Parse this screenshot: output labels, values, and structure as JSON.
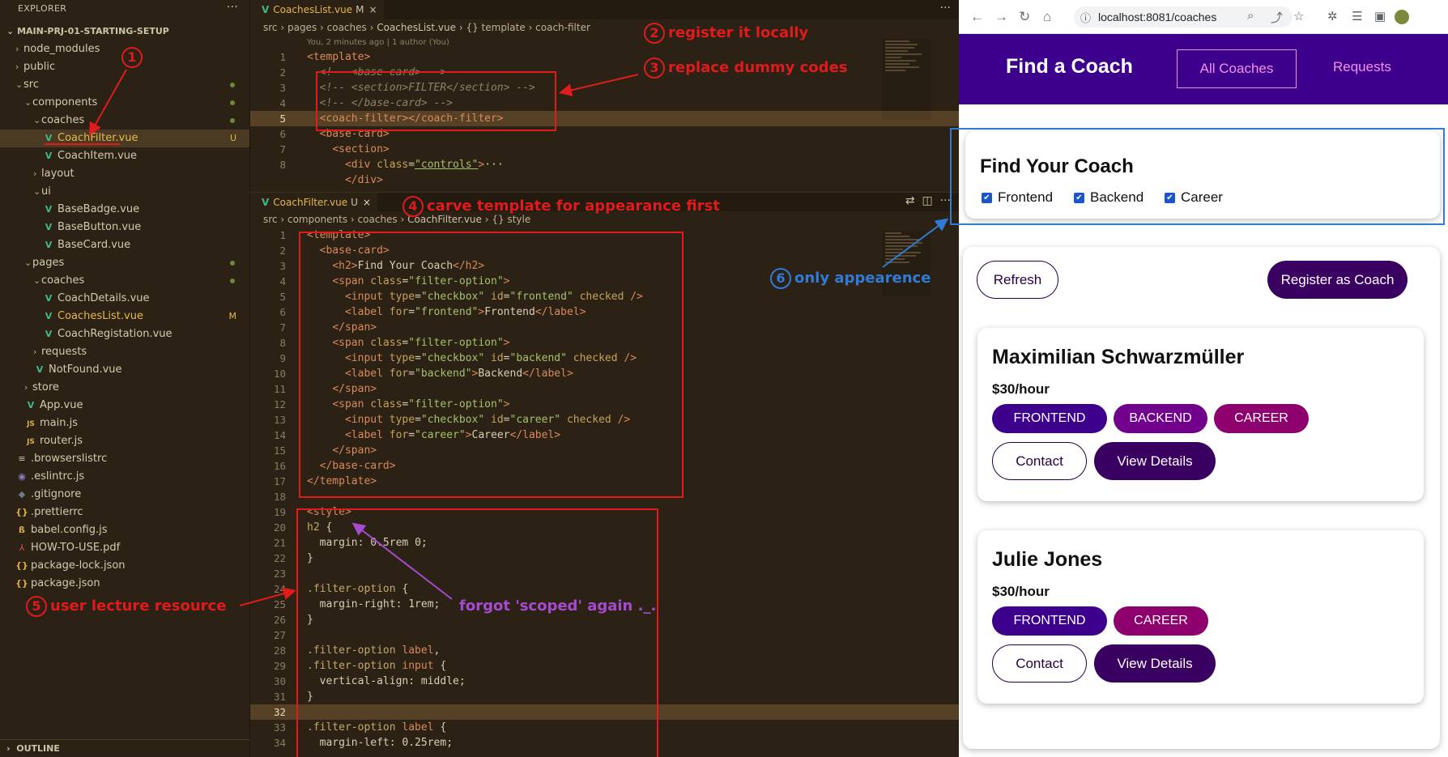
{
  "explorer": {
    "title": "EXPLORER",
    "more": "···",
    "project": "MAIN-PRJ-01-STARTING-SETUP",
    "items": [
      {
        "label": "node_modules",
        "kind": "folder",
        "depth": 1,
        "open": false
      },
      {
        "label": "public",
        "kind": "folder",
        "depth": 1,
        "open": false
      },
      {
        "label": "src",
        "kind": "folder",
        "depth": 1,
        "open": true,
        "status": "dot"
      },
      {
        "label": "components",
        "kind": "folder",
        "depth": 2,
        "open": true,
        "status": "dot"
      },
      {
        "label": "coaches",
        "kind": "folder",
        "depth": 3,
        "open": true,
        "status": "dot"
      },
      {
        "label": "CoachFilter.vue",
        "kind": "vue",
        "depth": 4,
        "selected": true,
        "status": "U"
      },
      {
        "label": "CoachItem.vue",
        "kind": "vue",
        "depth": 4
      },
      {
        "label": "layout",
        "kind": "folder",
        "depth": 3,
        "open": false
      },
      {
        "label": "ui",
        "kind": "folder",
        "depth": 3,
        "open": true
      },
      {
        "label": "BaseBadge.vue",
        "kind": "vue",
        "depth": 4
      },
      {
        "label": "BaseButton.vue",
        "kind": "vue",
        "depth": 4
      },
      {
        "label": "BaseCard.vue",
        "kind": "vue",
        "depth": 4
      },
      {
        "label": "pages",
        "kind": "folder",
        "depth": 2,
        "open": true,
        "status": "dot"
      },
      {
        "label": "coaches",
        "kind": "folder",
        "depth": 3,
        "open": true,
        "status": "dot"
      },
      {
        "label": "CoachDetails.vue",
        "kind": "vue",
        "depth": 4
      },
      {
        "label": "CoachesList.vue",
        "kind": "vue",
        "depth": 4,
        "status": "M"
      },
      {
        "label": "CoachRegistation.vue",
        "kind": "vue",
        "depth": 4
      },
      {
        "label": "requests",
        "kind": "folder",
        "depth": 3,
        "open": false
      },
      {
        "label": "NotFound.vue",
        "kind": "vue",
        "depth": 3
      },
      {
        "label": "store",
        "kind": "folder",
        "depth": 2,
        "open": false
      },
      {
        "label": "App.vue",
        "kind": "vue",
        "depth": 2
      },
      {
        "label": "main.js",
        "kind": "js",
        "depth": 2
      },
      {
        "label": "router.js",
        "kind": "js",
        "depth": 2
      },
      {
        "label": ".browserslistrc",
        "kind": "file",
        "depth": 1
      },
      {
        "label": ".eslintrc.js",
        "kind": "eslint",
        "depth": 1
      },
      {
        "label": ".gitignore",
        "kind": "git",
        "depth": 1
      },
      {
        "label": ".prettierrc",
        "kind": "json",
        "depth": 1
      },
      {
        "label": "babel.config.js",
        "kind": "babel",
        "depth": 1
      },
      {
        "label": "HOW-TO-USE.pdf",
        "kind": "pdf",
        "depth": 1
      },
      {
        "label": "package-lock.json",
        "kind": "json",
        "depth": 1
      },
      {
        "label": "package.json",
        "kind": "json",
        "depth": 1
      }
    ],
    "outline": "OUTLINE"
  },
  "editor1": {
    "tab": {
      "name": "CoachesList.vue",
      "status": "M",
      "close": "×"
    },
    "more": "···",
    "breadcrumb": [
      "src",
      "pages",
      "coaches",
      "CoachesList.vue",
      "{} template",
      "coach-filter"
    ],
    "author": "You, 2 minutes ago | 1 author (You)",
    "lines": [
      {
        "n": "1",
        "html": "<span class=t>&lt;template&gt;</span>"
      },
      {
        "n": "2",
        "html": "  <span class=c>&lt;!-- &lt;base-card&gt; --&gt;</span>"
      },
      {
        "n": "3",
        "html": "  <span class=c>&lt;!-- &lt;section&gt;FILTER&lt;/section&gt; --&gt;</span>"
      },
      {
        "n": "4",
        "html": "  <span class=c>&lt;!-- &lt;/base-card&gt; --&gt;</span>"
      },
      {
        "n": "5",
        "html": "  <span class=t>&lt;coach-filter&gt;&lt;/coach-filter&gt;</span>",
        "hl": true
      },
      {
        "n": "6",
        "html": "  <span class=t>&lt;base-card&gt;</span>"
      },
      {
        "n": "7",
        "html": "    <span class=t>&lt;section&gt;</span>"
      },
      {
        "n": "8",
        "html": "      <span class=t>&lt;div</span> <span class=a>class</span>=<span class='s u'>\"controls\"</span><span class=t>&gt;</span><span class=p>···</span>"
      },
      {
        "n": "",
        "html": "      <span class=t>&lt;/div&gt;</span>"
      }
    ]
  },
  "editor2": {
    "tab": {
      "name": "CoachFilter.vue",
      "status": "U",
      "close": "×"
    },
    "breadcrumb": [
      "src",
      "components",
      "coaches",
      "CoachFilter.vue",
      "{} style"
    ],
    "lines": [
      {
        "n": "1",
        "html": "<span class=t>&lt;template&gt;</span>"
      },
      {
        "n": "2",
        "html": "  <span class=t>&lt;base-card&gt;</span>"
      },
      {
        "n": "3",
        "html": "    <span class=t>&lt;h2&gt;</span>Find Your Coach<span class=t>&lt;/h2&gt;</span>"
      },
      {
        "n": "4",
        "html": "    <span class=t>&lt;span</span> <span class=a>class</span>=<span class=s>\"filter-option\"</span><span class=t>&gt;</span>"
      },
      {
        "n": "5",
        "html": "      <span class=t>&lt;input</span> <span class=a>type</span>=<span class=s>\"checkbox\"</span> <span class=a>id</span>=<span class=s>\"frontend\"</span> <span class=a>checked</span> <span class=t>/&gt;</span>"
      },
      {
        "n": "6",
        "html": "      <span class=t>&lt;label</span> <span class=a>for</span>=<span class=s>\"frontend\"</span><span class=t>&gt;</span>Frontend<span class=t>&lt;/label&gt;</span>"
      },
      {
        "n": "7",
        "html": "    <span class=t>&lt;/span&gt;</span>"
      },
      {
        "n": "8",
        "html": "    <span class=t>&lt;span</span> <span class=a>class</span>=<span class=s>\"filter-option\"</span><span class=t>&gt;</span>"
      },
      {
        "n": "9",
        "html": "      <span class=t>&lt;input</span> <span class=a>type</span>=<span class=s>\"checkbox\"</span> <span class=a>id</span>=<span class=s>\"backend\"</span> <span class=a>checked</span> <span class=t>/&gt;</span>"
      },
      {
        "n": "10",
        "html": "      <span class=t>&lt;label</span> <span class=a>for</span>=<span class=s>\"backend\"</span><span class=t>&gt;</span>Backend<span class=t>&lt;/label&gt;</span>"
      },
      {
        "n": "11",
        "html": "    <span class=t>&lt;/span&gt;</span>"
      },
      {
        "n": "12",
        "html": "    <span class=t>&lt;span</span> <span class=a>class</span>=<span class=s>\"filter-option\"</span><span class=t>&gt;</span>"
      },
      {
        "n": "13",
        "html": "      <span class=t>&lt;input</span> <span class=a>type</span>=<span class=s>\"checkbox\"</span> <span class=a>id</span>=<span class=s>\"career\"</span> <span class=a>checked</span> <span class=t>/&gt;</span>"
      },
      {
        "n": "14",
        "html": "      <span class=t>&lt;label</span> <span class=a>for</span>=<span class=s>\"career\"</span><span class=t>&gt;</span>Career<span class=t>&lt;/label&gt;</span>"
      },
      {
        "n": "15",
        "html": "    <span class=t>&lt;/span&gt;</span>"
      },
      {
        "n": "16",
        "html": "  <span class=t>&lt;/base-card&gt;</span>"
      },
      {
        "n": "17",
        "html": "<span class=t>&lt;/template&gt;</span>"
      },
      {
        "n": "18",
        "html": ""
      },
      {
        "n": "19",
        "html": "<span class=t>&lt;style&gt;</span>"
      },
      {
        "n": "20",
        "html": "<span class=sel>h2</span> {"
      },
      {
        "n": "21",
        "html": "  <span class=pr>margin</span>: 0.5rem 0;"
      },
      {
        "n": "22",
        "html": "}"
      },
      {
        "n": "23",
        "html": ""
      },
      {
        "n": "24",
        "html": "<span class=sel>.filter-option</span> {"
      },
      {
        "n": "25",
        "html": "  <span class=pr>margin-right</span>: 1rem;"
      },
      {
        "n": "26",
        "html": "}"
      },
      {
        "n": "27",
        "html": ""
      },
      {
        "n": "28",
        "html": "<span class=sel>.filter-option</span> <span class=t>label</span>,"
      },
      {
        "n": "29",
        "html": "<span class=sel>.filter-option</span> <span class=t>input</span> {"
      },
      {
        "n": "30",
        "html": "  <span class=pr>vertical-align</span>: middle;"
      },
      {
        "n": "31",
        "html": "}"
      },
      {
        "n": "32",
        "html": "",
        "hl": true
      },
      {
        "n": "33",
        "html": "<span class=sel>.filter-option</span> <span class=t>label</span> {"
      },
      {
        "n": "34",
        "html": "  <span class=pr>margin-left</span>: 0.25rem;"
      }
    ]
  },
  "browser": {
    "url": "localhost:8081/coaches",
    "app": {
      "brand": "Find a Coach",
      "nav_all": "All Coaches",
      "nav_requests": "Requests"
    },
    "filter": {
      "title": "Find Your Coach",
      "options": [
        "Frontend",
        "Backend",
        "Career"
      ],
      "check": "✔"
    },
    "actions": {
      "refresh": "Refresh",
      "register": "Register as Coach"
    },
    "coaches": [
      {
        "name": "Maximilian Schwarzmüller",
        "rate": "$30/hour",
        "areas": [
          "FRONTEND",
          "BACKEND",
          "CAREER"
        ],
        "contact": "Contact",
        "details": "View Details"
      },
      {
        "name": "Julie Jones",
        "rate": "$30/hour",
        "areas": [
          "FRONTEND",
          "CAREER"
        ],
        "contact": "Contact",
        "details": "View Details"
      }
    ]
  },
  "annotations": {
    "a1": {
      "num": "1",
      "text": ""
    },
    "a2": {
      "num": "2",
      "text": "register it locally"
    },
    "a3": {
      "num": "3",
      "text": "replace dummy codes"
    },
    "a4": {
      "num": "4",
      "text": "carve template for appearance first"
    },
    "a5": {
      "num": "5",
      "text": "user lecture resource"
    },
    "a6": {
      "num": "6",
      "text": "only appearence"
    },
    "scoped": "forgot 'scoped' again ._."
  },
  "colors": {
    "app_header": "#3d008d",
    "accent_pink": "#f391e3",
    "chip_frontend": "#3d008d",
    "chip_backend": "#71008d",
    "chip_career": "#8d006e",
    "annotation_red": "#e01b1b",
    "annotation_blue": "#2f7bd6",
    "annotation_purple": "#a64bd0"
  }
}
